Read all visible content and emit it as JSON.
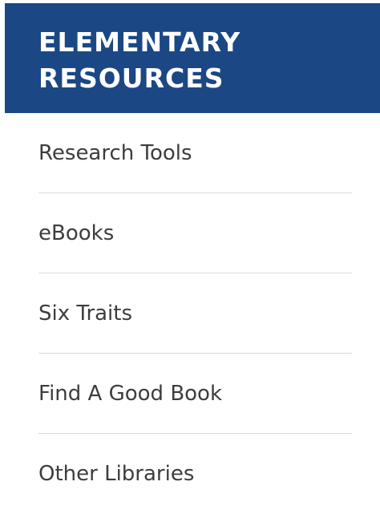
{
  "header": {
    "title": "ELEMENTARY RESOURCES"
  },
  "nav": {
    "items": [
      {
        "label": "Research Tools"
      },
      {
        "label": "eBooks"
      },
      {
        "label": "Six Traits"
      },
      {
        "label": "Find A Good Book"
      },
      {
        "label": "Other Libraries"
      }
    ]
  },
  "colors": {
    "header_bg": "#1b4785",
    "header_text": "#ffffff",
    "link_text": "#3d3d3d",
    "divider": "#d9d9d9"
  }
}
